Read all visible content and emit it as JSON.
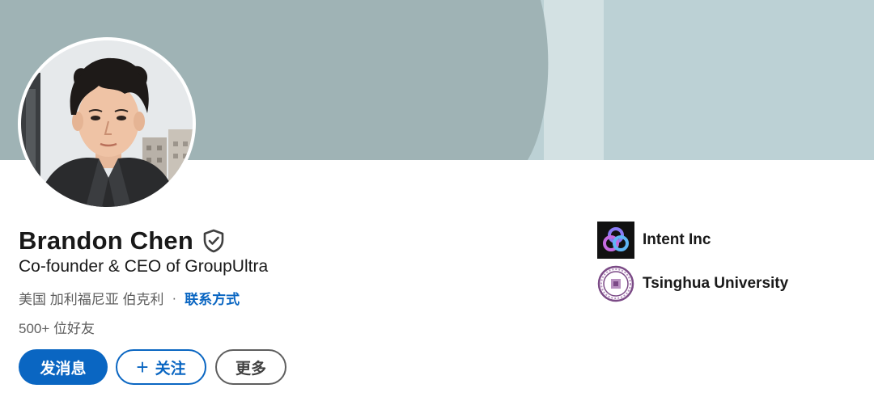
{
  "profile": {
    "name": "Brandon Chen",
    "headline": "Co-founder & CEO of GroupUltra",
    "location": "美国 加利福尼亚 伯克利",
    "separator": "·",
    "contact_link": "联系方式",
    "connections": "500+ 位好友"
  },
  "actions": {
    "message_label": "发消息",
    "follow_plus": "+",
    "follow_label": "关注",
    "more_label": "更多"
  },
  "affiliations": [
    {
      "label": "Intent Inc",
      "icon": "intent-logo-icon"
    },
    {
      "label": "Tsinghua University",
      "icon": "tsinghua-seal-icon"
    }
  ],
  "colors": {
    "accent": "#0a66c2",
    "banner_dark": "#9fb3b5",
    "banner_light": "#bcd1d5",
    "text_primary": "#191919",
    "text_secondary": "#5e5e5e"
  }
}
